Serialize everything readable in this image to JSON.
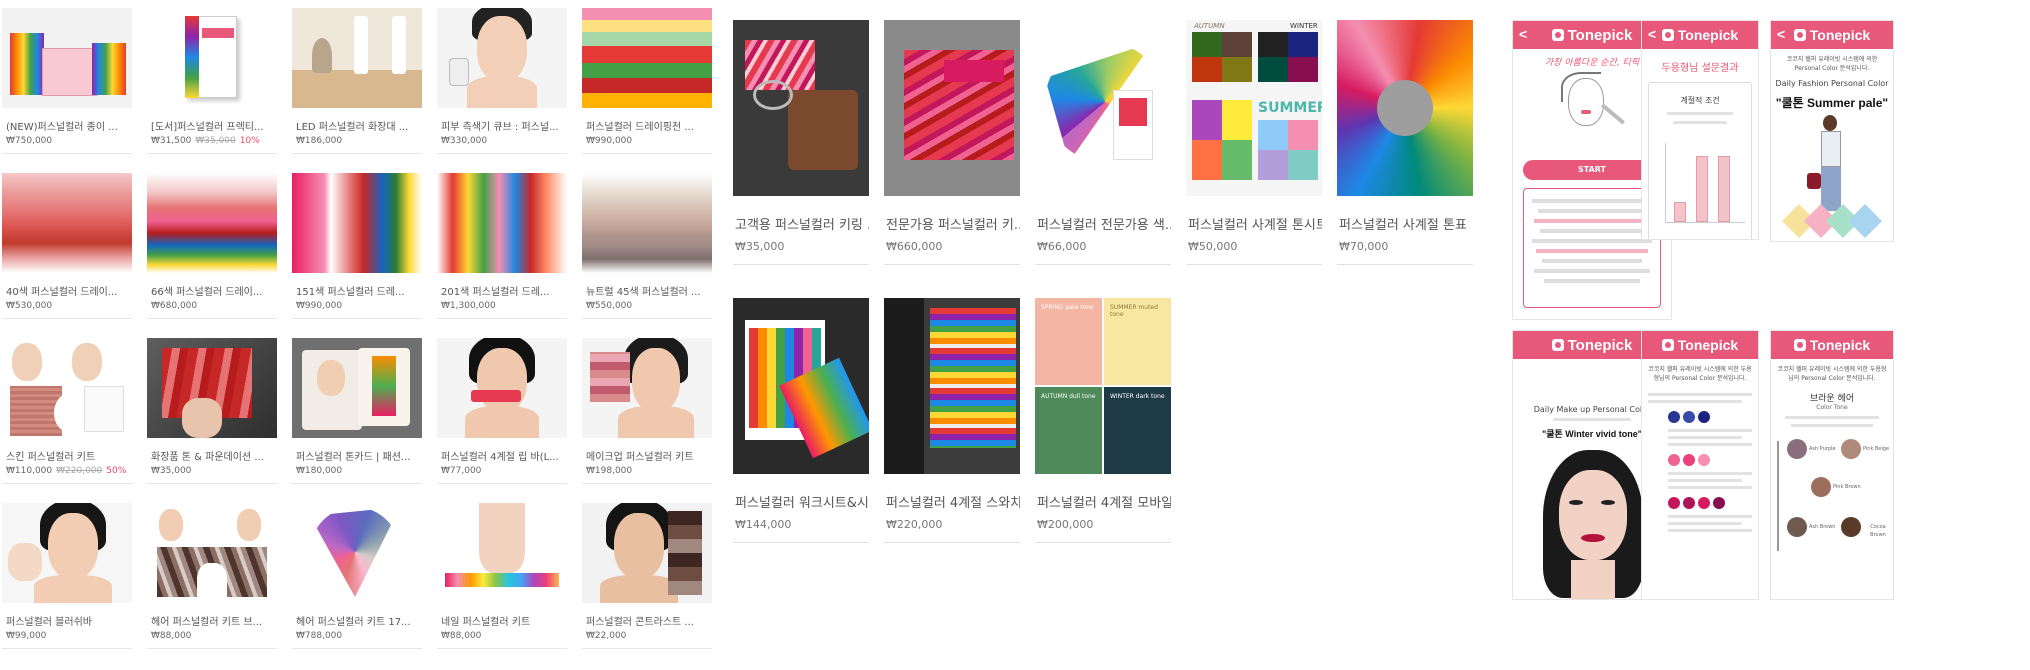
{
  "shop_grid": {
    "items": [
      {
        "name": "(NEW)퍼스널컬러 종이 ...",
        "price": "₩750,000",
        "was": "",
        "discount": ""
      },
      {
        "name": "[도서]퍼스널컬러 프렉티...",
        "price": "₩31,500",
        "was": "₩35,000",
        "discount": "10%"
      },
      {
        "name": "LED 퍼스널컬러 화장대 ...",
        "price": "₩186,000",
        "was": "",
        "discount": ""
      },
      {
        "name": "피부 측색기 큐브 : 퍼스널...",
        "price": "₩330,000",
        "was": "",
        "discount": ""
      },
      {
        "name": "퍼스널컬러 드레이핑천 ...",
        "price": "₩990,000",
        "was": "",
        "discount": ""
      },
      {
        "name": "40색 퍼스널컬러 드레이...",
        "price": "₩530,000",
        "was": "",
        "discount": ""
      },
      {
        "name": "66색 퍼스널컬러 드레이...",
        "price": "₩680,000",
        "was": "",
        "discount": ""
      },
      {
        "name": "151색 퍼스널컬러 드레...",
        "price": "₩990,000",
        "was": "",
        "discount": ""
      },
      {
        "name": "201색 퍼스널컬러 드레...",
        "price": "₩1,300,000",
        "was": "",
        "discount": ""
      },
      {
        "name": "뉴트럴 45색 퍼스널컬러 ...",
        "price": "₩550,000",
        "was": "",
        "discount": ""
      },
      {
        "name": "스킨 퍼스널컬러 키트",
        "price": "₩110,000",
        "was": "₩220,000",
        "discount": "50%"
      },
      {
        "name": "화장품 톤 & 파운데이션 ...",
        "price": "₩35,000",
        "was": "",
        "discount": ""
      },
      {
        "name": "퍼스널컬러 톤카드 | 패션...",
        "price": "₩180,000",
        "was": "",
        "discount": ""
      },
      {
        "name": "퍼스널컬러 4계절 립 바(L...",
        "price": "₩77,000",
        "was": "",
        "discount": ""
      },
      {
        "name": "메이크업 퍼스널컬러 키트",
        "price": "₩198,000",
        "was": "",
        "discount": ""
      },
      {
        "name": "퍼스널컬러 블러쉬바",
        "price": "₩99,000",
        "was": "",
        "discount": ""
      },
      {
        "name": "헤어 퍼스널컬러 키트 브...",
        "price": "₩88,000",
        "was": "",
        "discount": ""
      },
      {
        "name": "헤어 퍼스널컬러 키트 17...",
        "price": "₩788,000",
        "was": "",
        "discount": ""
      },
      {
        "name": "네일 퍼스널컬러 키트",
        "price": "₩88,000",
        "was": "",
        "discount": ""
      },
      {
        "name": "퍼스널컬러 콘트라스트 ...",
        "price": "₩22,000",
        "was": "",
        "discount": ""
      }
    ]
  },
  "shop_grid_large": {
    "items": [
      {
        "name": "고객용 퍼스널컬러 키링 ...",
        "price": "₩35,000"
      },
      {
        "name": "전문가용 퍼스널컬러 키...",
        "price": "₩660,000"
      },
      {
        "name": "퍼스널컬러 전문가용 색...",
        "price": "₩66,000"
      },
      {
        "name": "퍼스널컬러 사계절 톤시트",
        "price": "₩50,000"
      },
      {
        "name": "퍼스널컬러 사계절 톤표",
        "price": "₩70,000"
      },
      {
        "name": "퍼스널컬러 워크시트&시...",
        "price": "₩144,000"
      },
      {
        "name": "퍼스널컬러 4계절 스와치...",
        "price": "₩220,000"
      },
      {
        "name": "퍼스널컬러 4계절 모바일...",
        "price": "₩200,000"
      }
    ],
    "swatch_labels": {
      "autumn": "AUTUMN",
      "winter": "WINTER",
      "summer": "SUMMER",
      "spring_tone": "SPRING pale tone",
      "summer_tone": "SUMMER muted tone",
      "autumn_tone": "AUTUMN dull tone",
      "winter_tone": "WINTER dark tone"
    }
  },
  "app_screens": {
    "brand": "Tonepick",
    "back_glyph": "<",
    "s1": {
      "slogan": "가장 아름다운 순간, 티픽",
      "start": "START"
    },
    "s2": {
      "title": "두용형님 설문결과",
      "subtitle": "계절적 조건"
    },
    "s3": {
      "intro": "코코지 헬퍼 유레이빗 시스템에 의한 Personal Color 분석입니다.",
      "label": "Daily Fashion Personal Color",
      "result": "\"쿨톤 Summer pale\""
    },
    "s4": {
      "label": "Daily Make up Personal Color",
      "result": "\"쿨톤 Winter vivid tone\""
    },
    "s5": {
      "intro": "코코지 헬퍼 유레이빗 시스템에 의한 두용형님의 Personal Color 분석입니다."
    },
    "s6": {
      "title": "브라운 헤어",
      "subtitle": "Color Tone",
      "hair1": "Ash Purple",
      "hair2": "Pink Beige",
      "hair3": "Pink Brown",
      "hair4": "Ash Brown",
      "hair5": "Cocoa Brown"
    }
  },
  "colors": {
    "brand_pink": "#e8587a",
    "discount": "#e84a6b"
  }
}
